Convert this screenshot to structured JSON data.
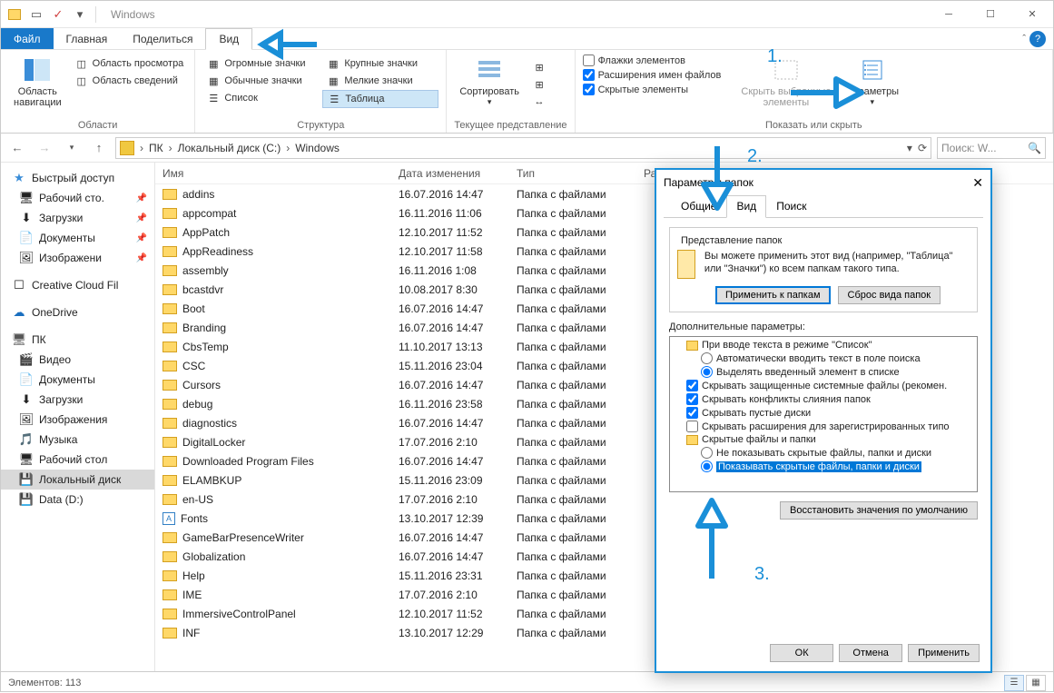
{
  "window": {
    "title": "Windows"
  },
  "tabs": {
    "file": "Файл",
    "home": "Главная",
    "share": "Поделиться",
    "view": "Вид"
  },
  "ribbon": {
    "panes": {
      "nav_pane": "Область\nнавигации",
      "preview": "Область просмотра",
      "details": "Область сведений",
      "caption": "Области"
    },
    "layout": {
      "huge": "Огромные значки",
      "large": "Крупные значки",
      "medium": "Обычные значки",
      "small": "Мелкие значки",
      "list": "Список",
      "details": "Таблица",
      "caption": "Структура"
    },
    "current": {
      "sort": "Сортировать",
      "caption": "Текущее представление"
    },
    "showhide": {
      "checkboxes": "Флажки элементов",
      "extensions": "Расширения имен файлов",
      "hidden": "Скрытые элементы",
      "hide_selected": "Скрыть выбранные\nэлементы",
      "options": "Параметры",
      "caption": "Показать или скрыть"
    }
  },
  "nav": {
    "back": "←",
    "fwd": "→",
    "up": "↑",
    "crumbs": [
      "ПК",
      "Локальный диск (C:)",
      "Windows"
    ],
    "search_placeholder": "Поиск: W..."
  },
  "sidebar": {
    "quick": "Быстрый доступ",
    "items1": [
      {
        "label": "Рабочий сто.",
        "pin": true
      },
      {
        "label": "Загрузки",
        "pin": true
      },
      {
        "label": "Документы",
        "pin": true
      },
      {
        "label": "Изображени",
        "pin": true
      }
    ],
    "ccf": "Creative Cloud Fil",
    "onedrive": "OneDrive",
    "pc": "ПК",
    "items2": [
      "Видео",
      "Документы",
      "Загрузки",
      "Изображения",
      "Музыка",
      "Рабочий стол",
      "Локальный диск",
      "Data (D:)"
    ]
  },
  "columns": {
    "name": "Имя",
    "date": "Дата изменения",
    "type": "Тип",
    "size": "Разм"
  },
  "files": [
    {
      "n": "addins",
      "d": "16.07.2016 14:47",
      "t": "Папка с файлами"
    },
    {
      "n": "appcompat",
      "d": "16.11.2016 11:06",
      "t": "Папка с файлами"
    },
    {
      "n": "AppPatch",
      "d": "12.10.2017 11:52",
      "t": "Папка с файлами"
    },
    {
      "n": "AppReadiness",
      "d": "12.10.2017 11:58",
      "t": "Папка с файлами"
    },
    {
      "n": "assembly",
      "d": "16.11.2016 1:08",
      "t": "Папка с файлами"
    },
    {
      "n": "bcastdvr",
      "d": "10.08.2017 8:30",
      "t": "Папка с файлами"
    },
    {
      "n": "Boot",
      "d": "16.07.2016 14:47",
      "t": "Папка с файлами"
    },
    {
      "n": "Branding",
      "d": "16.07.2016 14:47",
      "t": "Папка с файлами"
    },
    {
      "n": "CbsTemp",
      "d": "11.10.2017 13:13",
      "t": "Папка с файлами"
    },
    {
      "n": "CSC",
      "d": "15.11.2016 23:04",
      "t": "Папка с файлами"
    },
    {
      "n": "Cursors",
      "d": "16.07.2016 14:47",
      "t": "Папка с файлами"
    },
    {
      "n": "debug",
      "d": "16.11.2016 23:58",
      "t": "Папка с файлами"
    },
    {
      "n": "diagnostics",
      "d": "16.07.2016 14:47",
      "t": "Папка с файлами"
    },
    {
      "n": "DigitalLocker",
      "d": "17.07.2016 2:10",
      "t": "Папка с файлами"
    },
    {
      "n": "Downloaded Program Files",
      "d": "16.07.2016 14:47",
      "t": "Папка с файлами"
    },
    {
      "n": "ELAMBKUP",
      "d": "15.11.2016 23:09",
      "t": "Папка с файлами"
    },
    {
      "n": "en-US",
      "d": "17.07.2016 2:10",
      "t": "Папка с файлами"
    },
    {
      "n": "Fonts",
      "d": "13.10.2017 12:39",
      "t": "Папка с файлами",
      "icon": "font"
    },
    {
      "n": "GameBarPresenceWriter",
      "d": "16.07.2016 14:47",
      "t": "Папка с файлами"
    },
    {
      "n": "Globalization",
      "d": "16.07.2016 14:47",
      "t": "Папка с файлами"
    },
    {
      "n": "Help",
      "d": "15.11.2016 23:31",
      "t": "Папка с файлами"
    },
    {
      "n": "IME",
      "d": "17.07.2016 2:10",
      "t": "Папка с файлами"
    },
    {
      "n": "ImmersiveControlPanel",
      "d": "12.10.2017 11:52",
      "t": "Папка с файлами"
    },
    {
      "n": "INF",
      "d": "13.10.2017 12:29",
      "t": "Папка с файлами"
    }
  ],
  "status": {
    "count": "Элементов: 113"
  },
  "dialog": {
    "title": "Параметры папок",
    "tabs": {
      "general": "Общие",
      "view": "Вид",
      "search": "Поиск"
    },
    "folder_views": {
      "title": "Представление папок",
      "desc": "Вы можете применить этот вид (например, \"Таблица\" или \"Значки\") ко всем папкам такого типа.",
      "apply": "Применить к папкам",
      "reset": "Сброс вида папок"
    },
    "advanced_label": "Дополнительные параметры:",
    "tree": [
      {
        "type": "folder",
        "label": "При вводе текста в режиме \"Список\""
      },
      {
        "type": "radio",
        "label": "Автоматически вводить текст в поле поиска",
        "checked": false,
        "l": 2
      },
      {
        "type": "radio",
        "label": "Выделять введенный элемент в списке",
        "checked": true,
        "l": 2
      },
      {
        "type": "check",
        "label": "Скрывать защищенные системные файлы (рекомен.",
        "checked": true
      },
      {
        "type": "check",
        "label": "Скрывать конфликты слияния папок",
        "checked": true
      },
      {
        "type": "check",
        "label": "Скрывать пустые диски",
        "checked": true
      },
      {
        "type": "check",
        "label": "Скрывать расширения для зарегистрированных типо",
        "checked": false
      },
      {
        "type": "folder",
        "label": "Скрытые файлы и папки"
      },
      {
        "type": "radio",
        "label": "Не показывать скрытые файлы, папки и диски",
        "checked": false,
        "l": 2
      },
      {
        "type": "radio",
        "label": "Показывать скрытые файлы, папки и диски",
        "checked": true,
        "l": 2,
        "highlight": true
      }
    ],
    "restore": "Восстановить значения по умолчанию",
    "ok": "ОК",
    "cancel": "Отмена",
    "apply": "Применить"
  },
  "anno": {
    "n1": "1.",
    "n2": "2.",
    "n3": "3."
  }
}
